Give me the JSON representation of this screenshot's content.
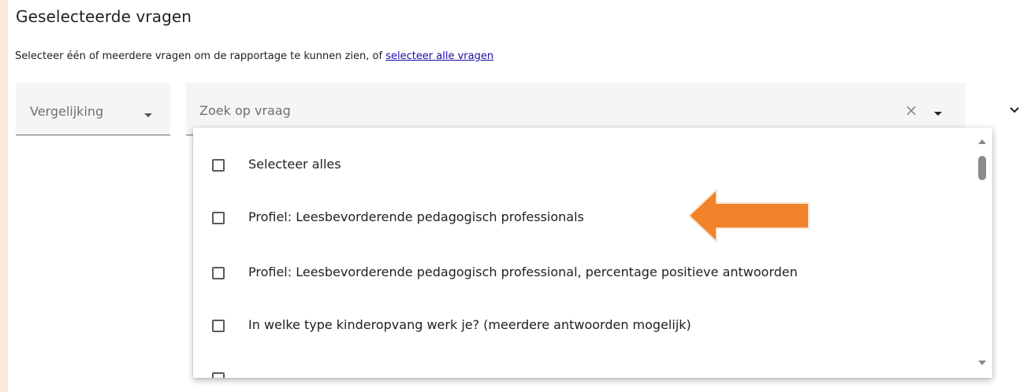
{
  "section": {
    "title": "Geselecteerde vragen",
    "instruction_text": "Selecteer één of meerdere vragen om de rapportage te kunnen zien, of ",
    "select_all_link": "selecteer alle vragen"
  },
  "compare": {
    "label": "Vergelijking"
  },
  "search": {
    "placeholder": "Zoek op vraag",
    "value": ""
  },
  "options": [
    {
      "label": "Selecteer alles",
      "checked": false
    },
    {
      "label": "Profiel: Leesbevorderende pedagogisch professionals",
      "checked": false
    },
    {
      "label": "Profiel: Leesbevorderende pedagogisch professional, percentage positieve antwoorden",
      "checked": false
    },
    {
      "label": "In welke type kinderopvang werk je? (meerdere antwoorden mogelijk)",
      "checked": false
    }
  ],
  "colors": {
    "annotation_arrow": "#f0822a",
    "background": "#fde7d6",
    "link": "#1a0dab"
  },
  "icons": {
    "clear": "close-icon",
    "dropdown": "caret-down-icon",
    "annotation": "arrow-left-annotation",
    "side": "chevron-down-icon"
  }
}
